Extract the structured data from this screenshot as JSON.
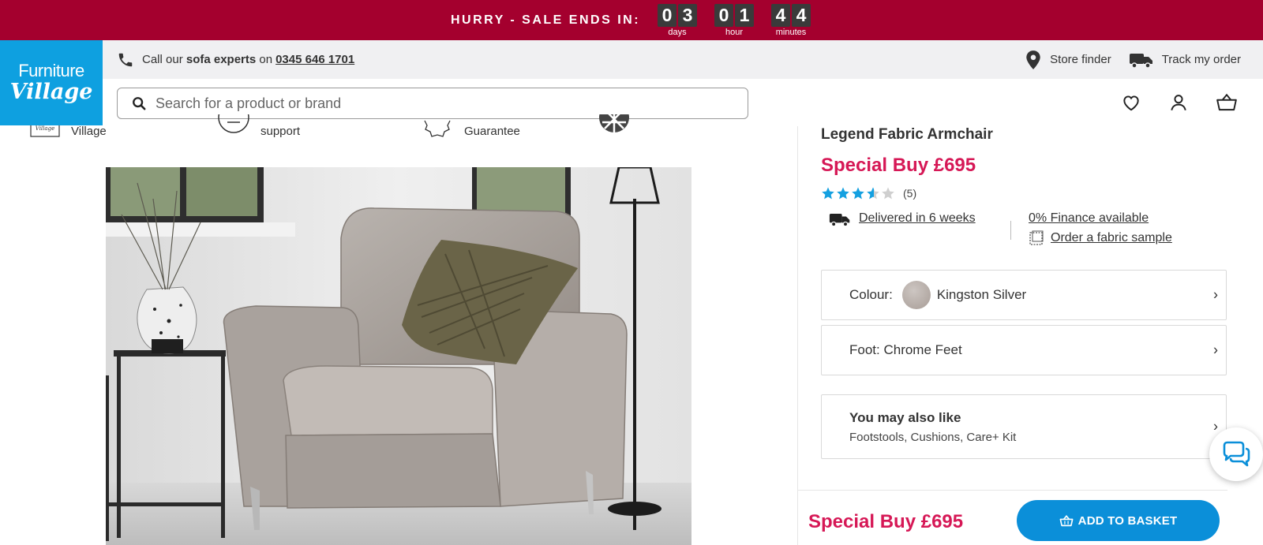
{
  "sale_banner": {
    "text": "HURRY - SALE ENDS IN:",
    "countdown": [
      {
        "digits": [
          "0",
          "3"
        ],
        "label": "days"
      },
      {
        "digits": [
          "0",
          "1"
        ],
        "label": "hour"
      },
      {
        "digits": [
          "4",
          "4"
        ],
        "label": "minutes"
      }
    ]
  },
  "logo": {
    "line1": "Furniture",
    "line2": "Village"
  },
  "utility": {
    "call_prefix": "Call our",
    "call_bold": "sofa experts",
    "call_on": "on",
    "phone": "0345 646 1701",
    "store_finder": "Store finder",
    "track_order": "Track my order"
  },
  "search": {
    "placeholder": "Search for a product or brand"
  },
  "usps": [
    {
      "text": "Village"
    },
    {
      "text": "support"
    },
    {
      "text": "Guarantee"
    }
  ],
  "product": {
    "title": "Legend Fabric Armchair",
    "price": "Special Buy £695",
    "rating": 3.5,
    "review_count": "(5)",
    "delivery": "Delivered in 6 weeks",
    "finance": "0% Finance available",
    "sample": "Order a fabric sample",
    "colour_label": "Colour:",
    "colour_value": "Kingston Silver",
    "foot": "Foot: Chrome Feet",
    "also_like_title": "You may also like",
    "also_like_sub": "Footstools, Cushions, Care+ Kit"
  },
  "sticky": {
    "price": "Special Buy £695",
    "add_to_basket": "ADD TO BASKET"
  },
  "colors": {
    "banner": "#a4002e",
    "logo": "#0ea0e0",
    "price": "#d61856",
    "button": "#0b8fd9",
    "star": "#14a0e0"
  }
}
